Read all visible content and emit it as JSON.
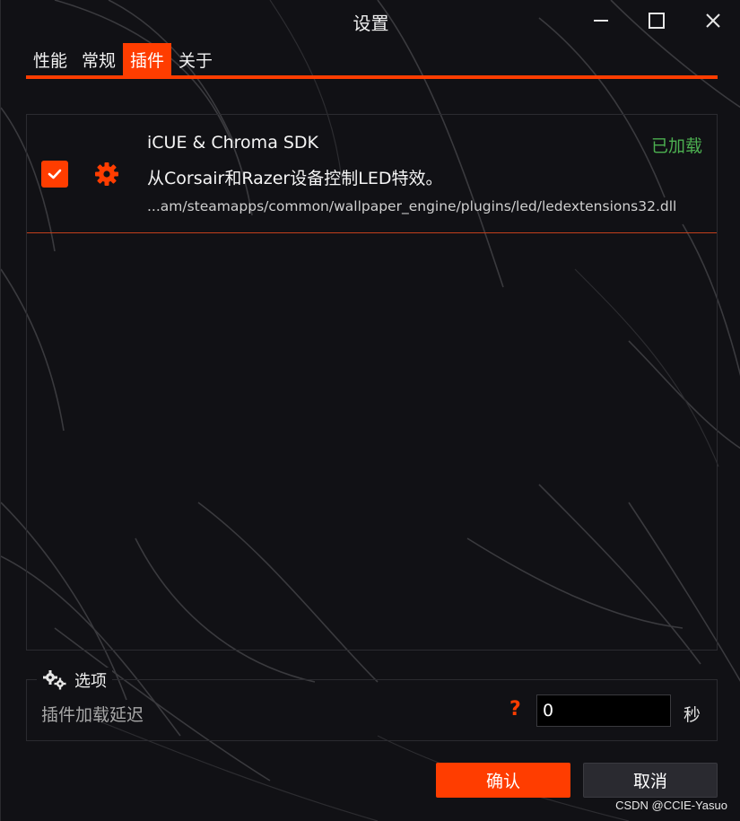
{
  "window": {
    "title": "设置"
  },
  "tabs": [
    {
      "label": "性能",
      "active": false
    },
    {
      "label": "常规",
      "active": false
    },
    {
      "label": "插件",
      "active": true
    },
    {
      "label": "关于",
      "active": false
    }
  ],
  "plugin": {
    "enabled": true,
    "name": "iCUE & Chroma SDK",
    "status": "已加载",
    "description": "从Corsair和Razer设备控制LED特效。",
    "path": "...am/steamapps/common/wallpaper_engine/plugins/led/ledextensions32.dll"
  },
  "options": {
    "section_label": "选项",
    "delay_label": "插件加载延迟",
    "help_symbol": "?",
    "delay_value": "0",
    "unit": "秒"
  },
  "buttons": {
    "ok": "确认",
    "cancel": "取消"
  },
  "watermark": "CSDN @CCIE-Yasuo",
  "colors": {
    "accent": "#ff3d00",
    "status_loaded": "#4caf50",
    "background": "#111115"
  },
  "icons": {
    "checkbox": "check-icon",
    "settings": "gear-icon",
    "options": "gears-icon",
    "minimize": "minimize-icon",
    "maximize": "maximize-icon",
    "close": "close-icon"
  }
}
